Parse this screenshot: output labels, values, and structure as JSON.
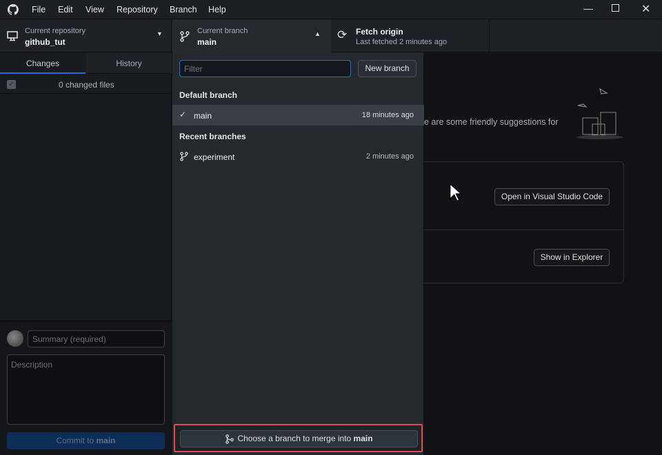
{
  "menu": [
    "File",
    "Edit",
    "View",
    "Repository",
    "Branch",
    "Help"
  ],
  "toolbar": {
    "repo_label": "Current repository",
    "repo_name": "github_tut",
    "branch_label": "Current branch",
    "branch_name": "main",
    "fetch_label": "Fetch origin",
    "fetch_sub": "Last fetched 2 minutes ago"
  },
  "sidebar": {
    "tabs": [
      "Changes",
      "History"
    ],
    "changed_files": "0 changed files",
    "summary_placeholder": "Summary (required)",
    "description_placeholder": "Description",
    "commit_prefix": "Commit to ",
    "commit_branch": "main"
  },
  "dropdown": {
    "filter_placeholder": "Filter",
    "new_branch": "New branch",
    "default_header": "Default branch",
    "default_branches": [
      {
        "name": "main",
        "time": "18 minutes ago"
      }
    ],
    "recent_header": "Recent branches",
    "recent_branches": [
      {
        "name": "experiment",
        "time": "2 minutes ago"
      }
    ],
    "merge_prefix": "Choose a branch to merge into ",
    "merge_branch": "main"
  },
  "main": {
    "suggestion_text": "e are some friendly suggestions for",
    "open_editor": "Open in Visual Studio Code",
    "show_explorer": "Show in Explorer"
  },
  "colors": {
    "accent": "#1f6feb",
    "highlight": "#e5484d",
    "commit_button": "#0c2d56"
  }
}
